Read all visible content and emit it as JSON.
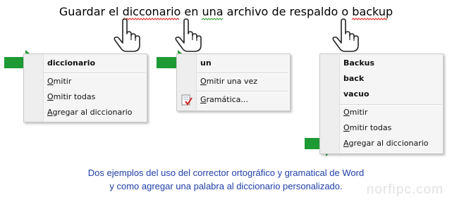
{
  "sentence": {
    "words": [
      {
        "text": "Guardar",
        "error": "none"
      },
      {
        "text": "el",
        "error": "none"
      },
      {
        "text": "dicconario",
        "error": "spelling"
      },
      {
        "text": "en",
        "error": "none"
      },
      {
        "text": "una",
        "error": "grammar"
      },
      {
        "text": "archivo",
        "error": "none"
      },
      {
        "text": "de",
        "error": "none"
      },
      {
        "text": "respaldo",
        "error": "none"
      },
      {
        "text": "o",
        "error": "none"
      },
      {
        "text": "backup",
        "error": "spelling"
      }
    ],
    "spelling_color": "#e02020",
    "grammar_color": "#2a9d2a"
  },
  "menus": {
    "menu1": {
      "suggestion": "diccionario",
      "omit": {
        "u": "O",
        "rest": "mitir"
      },
      "omit_all": {
        "u": "O",
        "rest": "mitir todas"
      },
      "add": {
        "u": "A",
        "rest": "gregar al diccionario"
      }
    },
    "menu2": {
      "suggestion": "un",
      "omit_once": {
        "u": "O",
        "rest": "mitir una vez"
      },
      "grammar": {
        "u": "G",
        "rest": "ramática..."
      }
    },
    "menu3": {
      "suggestions": [
        "Backus",
        "back",
        "vacuo"
      ],
      "omit": {
        "u": "O",
        "rest": "mitir"
      },
      "omit_all": {
        "u": "O",
        "rest": "mitir todas"
      },
      "add": {
        "u": "A",
        "rest": "gregar al diccionario"
      }
    }
  },
  "caption": {
    "line1": "Dos ejemplos del uso del corrector ortográfico y gramatical de Word",
    "line2": "y como agregar una palabra al diccionario personalizado."
  },
  "watermark": "norfipc.com",
  "colors": {
    "arrow": "#1e9a35",
    "caption": "#1f3ea8"
  },
  "icons": [
    "hand-pointer-icon",
    "green-arrow-icon",
    "grammar-check-icon"
  ]
}
